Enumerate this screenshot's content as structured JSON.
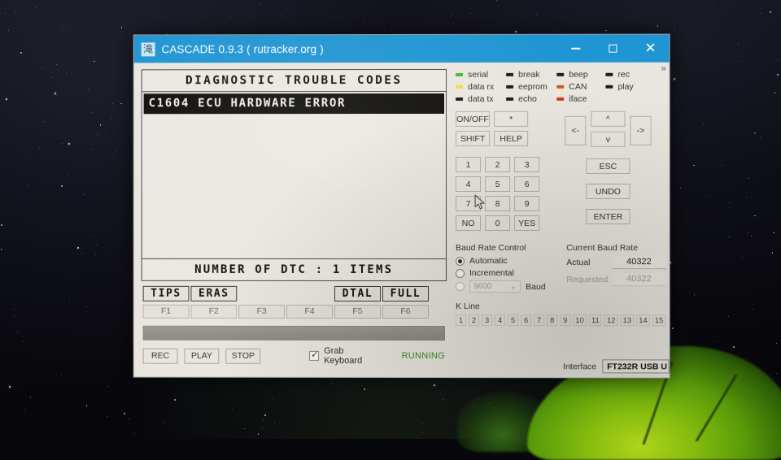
{
  "window": {
    "title": "CASCADE 0.9.3 ( rutracker.org )",
    "app_icon": "滝",
    "minimize_label": "",
    "maximize_label": "",
    "close_label": "✕",
    "overflow_label": "»"
  },
  "terminal": {
    "header": "DIAGNOSTIC TROUBLE CODES",
    "dtc_rows": [
      {
        "text": "C1604 ECU HARDWARE ERROR",
        "selected": true
      }
    ],
    "footer": "NUMBER OF DTC  :   1 ITEMS"
  },
  "fkeys": [
    {
      "label": "TIPS",
      "key": "F1",
      "filled": true
    },
    {
      "label": "ERAS",
      "key": "F2",
      "filled": true
    },
    {
      "label": "",
      "key": "F3",
      "filled": false
    },
    {
      "label": "",
      "key": "F4",
      "filled": false
    },
    {
      "label": "DTAL",
      "key": "F5",
      "filled": true
    },
    {
      "label": "FULL",
      "key": "F6",
      "filled": true
    }
  ],
  "transport": {
    "rec_label": "REC",
    "play_label": "PLAY",
    "stop_label": "STOP",
    "grab_keyboard_label": "Grab Keyboard",
    "grab_keyboard_checked": true,
    "status_text": "RUNNING",
    "status_color": "#3f8b2a"
  },
  "leds": [
    {
      "name": "serial",
      "color": "#3fbb2c"
    },
    {
      "name": "break",
      "color": "#1d1c19"
    },
    {
      "name": "beep",
      "color": "#1d1c19"
    },
    {
      "name": "rec",
      "color": "#1d1c19"
    },
    {
      "name": "data rx",
      "color": "#e8e332"
    },
    {
      "name": "eeprom",
      "color": "#1d1c19"
    },
    {
      "name": "CAN",
      "color": "#cd5a14"
    },
    {
      "name": "play",
      "color": "#1d1c19"
    },
    {
      "name": "data tx",
      "color": "#1d1c19"
    },
    {
      "name": "echo",
      "color": "#1d1c19"
    },
    {
      "name": "iface",
      "color": "#d8351a"
    },
    {
      "name": "",
      "color": "transparent"
    }
  ],
  "keypad": {
    "rows": [
      [
        {
          "label": "ON/OFF",
          "size": "w-lg"
        },
        {
          "label": "*",
          "size": "w-lg"
        }
      ],
      [
        {
          "label": "SHIFT",
          "size": "w-lg"
        },
        {
          "label": "HELP",
          "size": "w-lg"
        }
      ],
      [
        {
          "label": "1",
          "size": "w-sm"
        },
        {
          "label": "2",
          "size": "w-sm"
        },
        {
          "label": "3",
          "size": "w-sm"
        }
      ],
      [
        {
          "label": "4",
          "size": "w-sm"
        },
        {
          "label": "5",
          "size": "w-sm"
        },
        {
          "label": "6",
          "size": "w-sm"
        }
      ],
      [
        {
          "label": "7",
          "size": "w-sm"
        },
        {
          "label": "8",
          "size": "w-sm"
        },
        {
          "label": "9",
          "size": "w-sm"
        }
      ],
      [
        {
          "label": "NO",
          "size": "w-sm"
        },
        {
          "label": "0",
          "size": "w-sm"
        },
        {
          "label": "YES",
          "size": "w-sm"
        }
      ]
    ],
    "dpad": {
      "left": "<-",
      "up": "^",
      "down": "v",
      "right": "->"
    },
    "esc_label": "ESC",
    "undo_label": "UNDO",
    "enter_label": "ENTER"
  },
  "baud": {
    "control_title": "Baud Rate Control",
    "automatic_label": "Automatic",
    "automatic_selected": true,
    "incremental_label": "Incremental",
    "incremental_selected": false,
    "manual_selected": false,
    "manual_value": "9600",
    "manual_unit": "Baud",
    "dropdown_caret": "⌄",
    "current_title": "Current Baud Rate",
    "actual_label": "Actual",
    "actual_value": "40322",
    "requested_label": "Requested",
    "requested_value": "40322"
  },
  "kline": {
    "title": "K Line",
    "channels": [
      "1",
      "2",
      "3",
      "4",
      "5",
      "6",
      "7",
      "8",
      "9",
      "10",
      "11",
      "12",
      "13",
      "14",
      "15"
    ]
  },
  "interface": {
    "label": "Interface",
    "value": "FT232R USB U"
  }
}
